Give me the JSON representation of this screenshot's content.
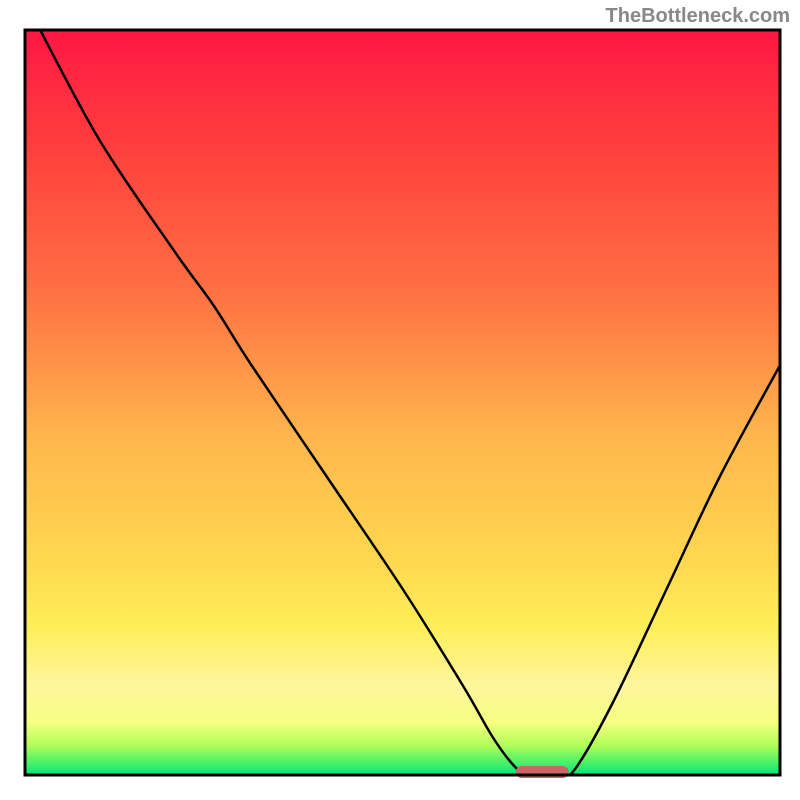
{
  "watermark": "TheBottleneck.com",
  "chart_data": {
    "type": "line",
    "title": "",
    "xlabel": "",
    "ylabel": "",
    "xlim": [
      0,
      100
    ],
    "ylim": [
      0,
      100
    ],
    "background": {
      "type": "vertical-gradient",
      "stops": [
        {
          "offset": 0,
          "color": "#FF1744"
        },
        {
          "offset": 15,
          "color": "#FF3D3D"
        },
        {
          "offset": 35,
          "color": "#FF7043"
        },
        {
          "offset": 55,
          "color": "#FFB74D"
        },
        {
          "offset": 70,
          "color": "#FFD54F"
        },
        {
          "offset": 80,
          "color": "#FFEE58"
        },
        {
          "offset": 88,
          "color": "#FFF59D"
        },
        {
          "offset": 93,
          "color": "#F4FF81"
        },
        {
          "offset": 96,
          "color": "#B2FF59"
        },
        {
          "offset": 100,
          "color": "#00E676"
        }
      ]
    },
    "series": [
      {
        "name": "bottleneck-curve",
        "color": "#000000",
        "stroke_width": 2.5,
        "points": [
          {
            "x": 2,
            "y": 100
          },
          {
            "x": 10,
            "y": 85
          },
          {
            "x": 20,
            "y": 70
          },
          {
            "x": 25,
            "y": 63
          },
          {
            "x": 30,
            "y": 55
          },
          {
            "x": 40,
            "y": 40
          },
          {
            "x": 50,
            "y": 25
          },
          {
            "x": 58,
            "y": 12
          },
          {
            "x": 62,
            "y": 5
          },
          {
            "x": 65,
            "y": 1
          },
          {
            "x": 67,
            "y": 0
          },
          {
            "x": 71,
            "y": 0
          },
          {
            "x": 73,
            "y": 1
          },
          {
            "x": 78,
            "y": 10
          },
          {
            "x": 85,
            "y": 25
          },
          {
            "x": 92,
            "y": 40
          },
          {
            "x": 100,
            "y": 55
          }
        ]
      }
    ],
    "marker": {
      "name": "optimal-zone",
      "x_start": 65,
      "x_end": 72,
      "y": 0,
      "color": "#CC6666",
      "shape": "rounded-bar"
    },
    "border": {
      "color": "#000000",
      "width": 3
    }
  }
}
